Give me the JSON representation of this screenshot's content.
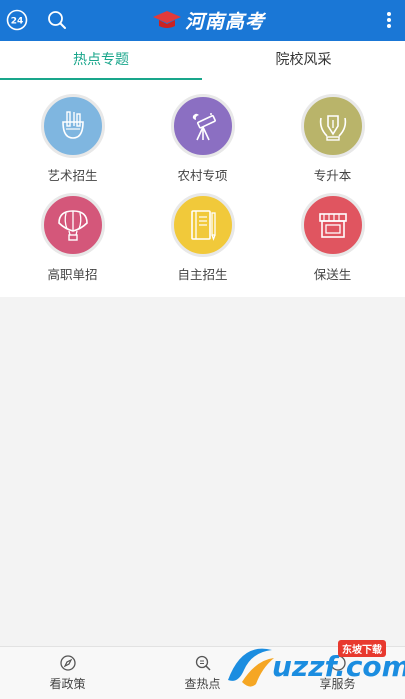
{
  "header": {
    "title": "河南高考",
    "icons": [
      "24h-icon",
      "search-icon",
      "cap-icon",
      "more-icon"
    ],
    "accent": "#1a77d6"
  },
  "tabs": [
    {
      "label": "热点专题",
      "active": true
    },
    {
      "label": "院校风采",
      "active": false
    }
  ],
  "topics": [
    {
      "label": "艺术招生",
      "color": "#7fb6e0",
      "icon": "art-tools-icon"
    },
    {
      "label": "农村专项",
      "color": "#8b6fc2",
      "icon": "telescope-icon"
    },
    {
      "label": "专升本",
      "color": "#b9b46a",
      "icon": "pen-laurel-icon"
    },
    {
      "label": "高职单招",
      "color": "#d4577a",
      "icon": "balloon-icon"
    },
    {
      "label": "自主招生",
      "color": "#f1c93a",
      "icon": "notebook-icon"
    },
    {
      "label": "保送生",
      "color": "#e05560",
      "icon": "storefront-icon"
    }
  ],
  "bottom_nav": [
    {
      "label": "看政策",
      "icon": "compass-icon"
    },
    {
      "label": "查热点",
      "icon": "search-doc-icon"
    },
    {
      "label": "享服务",
      "icon": "service-icon"
    }
  ],
  "watermark": {
    "text": "uzzf.com",
    "badge": "东坡下载"
  }
}
